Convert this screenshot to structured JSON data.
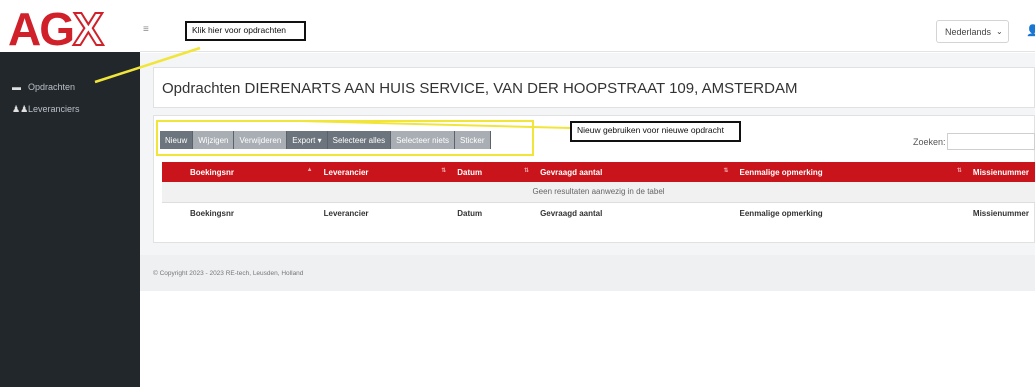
{
  "logo": {
    "a": "AG",
    "x": "X"
  },
  "sidebar": {
    "items": [
      {
        "icon": "folder-icon",
        "glyph": "▬",
        "label": "Opdrachten"
      },
      {
        "icon": "users-icon",
        "glyph": "♟♟",
        "label": "Leveranciers"
      }
    ]
  },
  "topbar": {
    "menu_glyph": "≡",
    "language": "Nederlands",
    "language_caret": "⌄",
    "user_glyph": "👤"
  },
  "annotations": {
    "top": "Klik hier voor opdrachten",
    "new": "Nieuw gebruiken voor nieuwe opdracht"
  },
  "page": {
    "title": "Opdrachten DIERENARTS AAN HUIS SERVICE, VAN DER HOOPSTRAAT 109, AMSTERDAM"
  },
  "toolbar": {
    "new": "Nieuw",
    "edit": "Wijzigen",
    "delete": "Verwijderen",
    "export": "Export ▾",
    "select_all": "Selecteer alles",
    "select_none": "Selecteer niets",
    "sticker": "Sticker"
  },
  "search": {
    "label": "Zoeken:",
    "value": ""
  },
  "table": {
    "columns": [
      "",
      "Boekingsnr",
      "Leverancier",
      "Datum",
      "Gevraagd aantal",
      "Eenmalige opmerking",
      "Missienummer"
    ],
    "empty_message": "Geen resultaten aanwezig in de tabel",
    "footer": [
      "",
      "Boekingsnr",
      "Leverancier",
      "Datum",
      "Gevraagd aantal",
      "Eenmalige opmerking",
      "Missienummer"
    ]
  },
  "footer": {
    "copyright": "© Copyright 2023 - 2023 RE-tech, Leusden, Holland"
  },
  "colors": {
    "accent": "#c9141b",
    "sidebar": "#22272c",
    "highlight": "#f2e53a"
  }
}
